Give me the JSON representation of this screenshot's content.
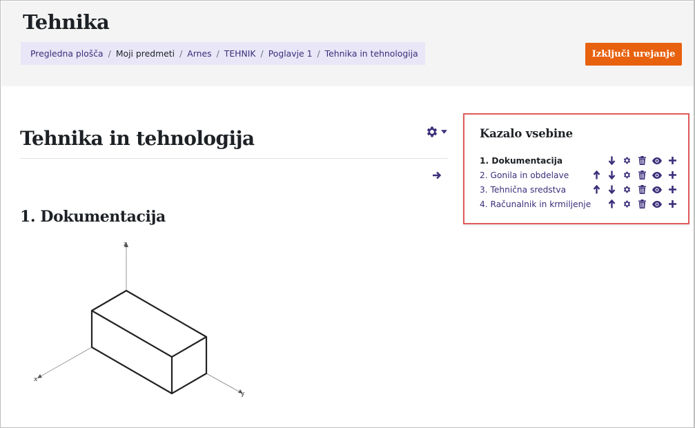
{
  "header": {
    "course_title": "Tehnika",
    "breadcrumb": [
      {
        "label": "Pregledna plošča"
      },
      {
        "label": "Moji predmeti"
      },
      {
        "label": "Arnes"
      },
      {
        "label": "TEHNIK"
      },
      {
        "label": "Poglavje 1"
      },
      {
        "label": "Tehnika in tehnologija"
      }
    ],
    "edit_button_label": "Izključi urejanje"
  },
  "main": {
    "section_title": "Tehnika in tehnologija",
    "subsection_title": "1. Dokumentacija",
    "diagram_axis_labels": {
      "z": "z",
      "x": "x",
      "y": "y"
    }
  },
  "toc": {
    "title": "Kazalo vsebine",
    "items": [
      {
        "label": "1. Dokumentacija",
        "active": true,
        "up": false,
        "down": true
      },
      {
        "label": "2. Gonila in obdelave",
        "active": false,
        "up": true,
        "down": true
      },
      {
        "label": "3. Tehnična sredstva",
        "active": false,
        "up": true,
        "down": true
      },
      {
        "label": "4. Računalnik in krmiljenje",
        "active": false,
        "up": true,
        "down": false
      }
    ]
  },
  "colors": {
    "accent": "#3a2f7a",
    "edit_button": "#e8610e",
    "highlight_border": "#e05a5a",
    "breadcrumb_bg": "#e8e6f7",
    "header_bg": "#f4f4f4"
  },
  "icons": [
    "gear-icon",
    "caret-down-icon",
    "arrow-right-icon",
    "arrow-up-icon",
    "arrow-down-icon",
    "trash-icon",
    "eye-icon",
    "plus-icon"
  ]
}
